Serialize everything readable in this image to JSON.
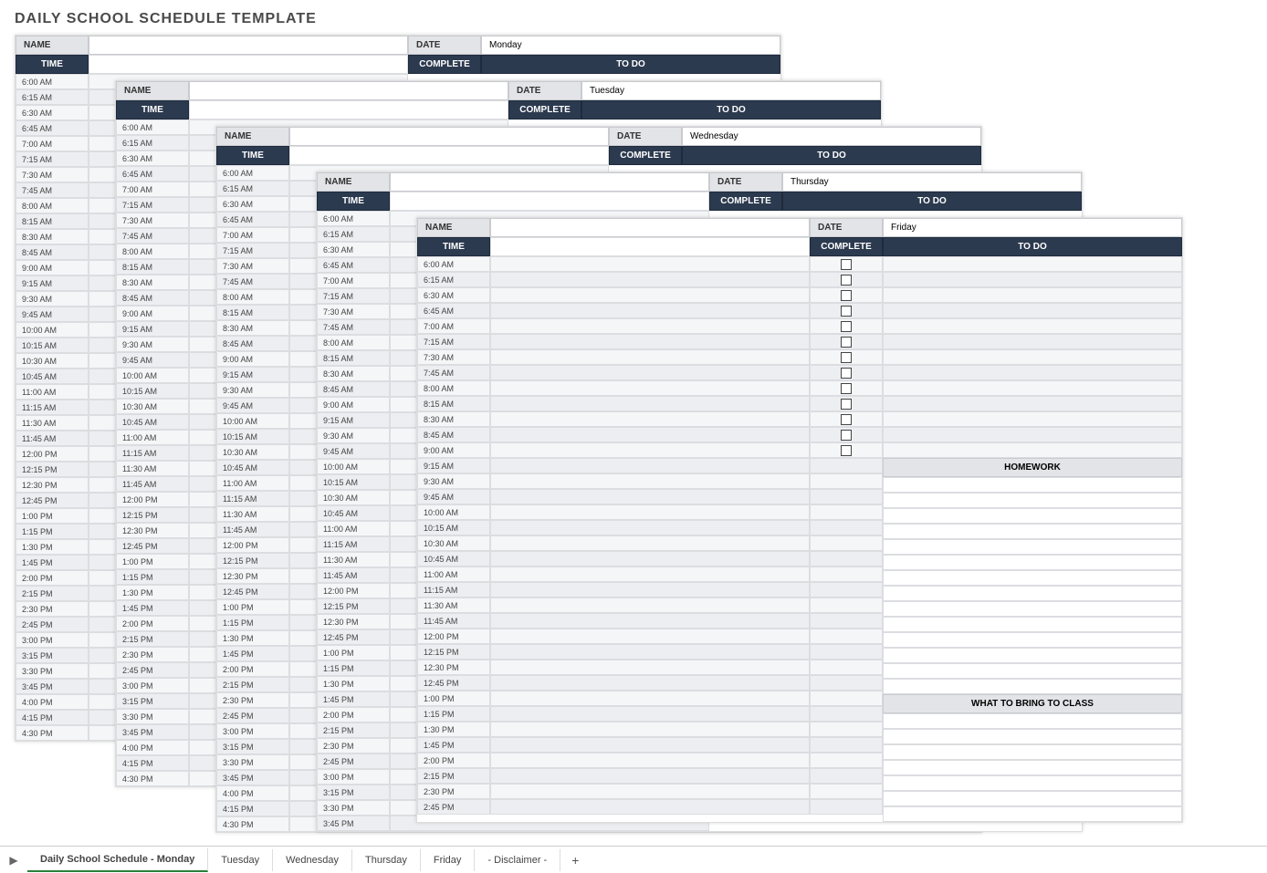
{
  "title": "DAILY SCHOOL SCHEDULE TEMPLATE",
  "labels": {
    "name": "NAME",
    "date": "DATE",
    "time": "TIME",
    "complete": "COMPLETE",
    "todo": "TO DO",
    "homework": "HOMEWORK",
    "bring": "WHAT TO BRING TO CLASS"
  },
  "days": [
    "Monday",
    "Tuesday",
    "Wednesday",
    "Thursday",
    "Friday"
  ],
  "times": [
    "6:00 AM",
    "6:15 AM",
    "6:30 AM",
    "6:45 AM",
    "7:00 AM",
    "7:15 AM",
    "7:30 AM",
    "7:45 AM",
    "8:00 AM",
    "8:15 AM",
    "8:30 AM",
    "8:45 AM",
    "9:00 AM",
    "9:15 AM",
    "9:30 AM",
    "9:45 AM",
    "10:00 AM",
    "10:15 AM",
    "10:30 AM",
    "10:45 AM",
    "11:00 AM",
    "11:15 AM",
    "11:30 AM",
    "11:45 AM",
    "12:00 PM",
    "12:15 PM",
    "12:30 PM",
    "12:45 PM",
    "1:00 PM",
    "1:15 PM",
    "1:30 PM",
    "1:45 PM",
    "2:00 PM",
    "2:15 PM",
    "2:30 PM",
    "2:45 PM",
    "3:00 PM",
    "3:15 PM",
    "3:30 PM",
    "3:45 PM",
    "4:00 PM",
    "4:15 PM",
    "4:30 PM"
  ],
  "tabs": [
    "Daily School Schedule - Monday",
    "Tuesday",
    "Wednesday",
    "Thursday",
    "Friday",
    "- Disclaimer -"
  ],
  "tabs_plus": "+"
}
